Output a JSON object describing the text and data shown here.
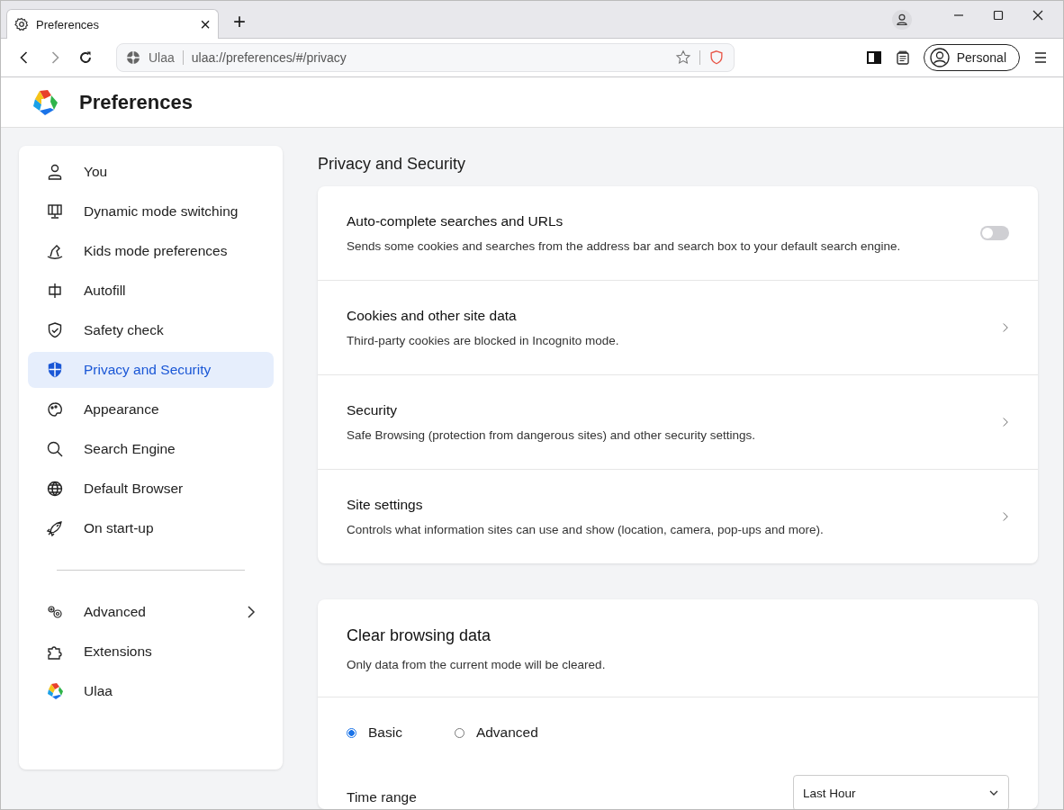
{
  "window": {
    "tab": {
      "title": "Preferences",
      "close": "×"
    },
    "new_tab": "+"
  },
  "address_bar": {
    "site": "Ulaa",
    "url": "ulaa://preferences/#/privacy"
  },
  "profile": {
    "label": "Personal"
  },
  "header": {
    "title": "Preferences"
  },
  "sidebar": {
    "items": [
      {
        "label": "You",
        "selected": false
      },
      {
        "label": "Dynamic mode switching",
        "selected": false
      },
      {
        "label": "Kids mode preferences",
        "selected": false
      },
      {
        "label": "Autofill",
        "selected": false
      },
      {
        "label": "Safety check",
        "selected": false
      },
      {
        "label": "Privacy and Security",
        "selected": true
      },
      {
        "label": "Appearance",
        "selected": false
      },
      {
        "label": "Search Engine",
        "selected": false
      },
      {
        "label": "Default Browser",
        "selected": false
      },
      {
        "label": "On start-up",
        "selected": false
      }
    ],
    "bottom_items": [
      {
        "label": "Advanced",
        "expandable": true
      },
      {
        "label": "Extensions",
        "expandable": false
      },
      {
        "label": "Ulaa",
        "expandable": false
      }
    ]
  },
  "main": {
    "section_title": "Privacy and Security",
    "rows": [
      {
        "kind": "toggle",
        "title": "Auto-complete searches and URLs",
        "description": "Sends some cookies and searches from the address bar and search box to your default search engine.",
        "on": false
      },
      {
        "kind": "link",
        "title": "Cookies and other site data",
        "description": "Third-party cookies are blocked in Incognito mode."
      },
      {
        "kind": "link",
        "title": "Security",
        "description": "Safe Browsing (protection from dangerous sites) and other security settings."
      },
      {
        "kind": "link",
        "title": "Site settings",
        "description": "Controls what information sites can use and show (location, camera, pop-ups and more)."
      }
    ]
  },
  "clear_data": {
    "title": "Clear browsing data",
    "description": "Only data from the current mode will be cleared.",
    "modes": [
      {
        "label": "Basic",
        "selected": true
      },
      {
        "label": "Advanced",
        "selected": false
      }
    ],
    "time_range": {
      "label": "Time range",
      "value": "Last Hour"
    }
  }
}
